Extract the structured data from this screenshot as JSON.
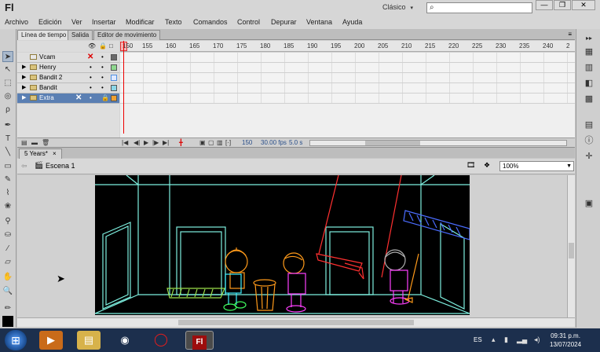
{
  "window": {
    "app_logo": "Fl",
    "workspace": "Clásico",
    "workspace_caret": "▾",
    "search_placeholder": "",
    "buttons": [
      "—",
      "❐",
      "✕"
    ]
  },
  "menubar": [
    "Archivo",
    "Edición",
    "Ver",
    "Insertar",
    "Modificar",
    "Texto",
    "Comandos",
    "Control",
    "Depurar",
    "Ventana",
    "Ayuda"
  ],
  "timeline": {
    "tabs": [
      "Línea de tiempo",
      "Salida",
      "Editor de movimiento"
    ],
    "ruler": [
      "150",
      "155",
      "160",
      "165",
      "170",
      "175",
      "180",
      "185",
      "190",
      "195",
      "200",
      "205",
      "210",
      "215",
      "220",
      "225",
      "230",
      "235",
      "240",
      "2"
    ],
    "layers": [
      {
        "name": "Vcam",
        "color": "#6a6a6a"
      },
      {
        "name": "Henry",
        "color": "#8fd88f"
      },
      {
        "name": "Bandit 2",
        "color": "#4f8fe0"
      },
      {
        "name": "Bandit",
        "color": "#8ad6e8"
      },
      {
        "name": "Extra",
        "color": "#f0a030"
      }
    ],
    "status": {
      "frame": "150",
      "fps": "30.00 fps",
      "time": "5.0 s"
    }
  },
  "document": {
    "tab": "5 Years*",
    "tab_close": "×",
    "scene": "Escena 1",
    "zoom": "100%"
  },
  "taskbar": {
    "lang": "ES",
    "time": "09:31 p.m.",
    "date": "13/07/2024",
    "flash_label": "Fl"
  },
  "colors": {
    "stage_bg": "#000000",
    "line_cyan": "#7ef0e0",
    "line_orange": "#ff9a1a",
    "line_pink": "#ff40ff",
    "line_red": "#ff3030",
    "line_blue": "#4a6cff"
  }
}
